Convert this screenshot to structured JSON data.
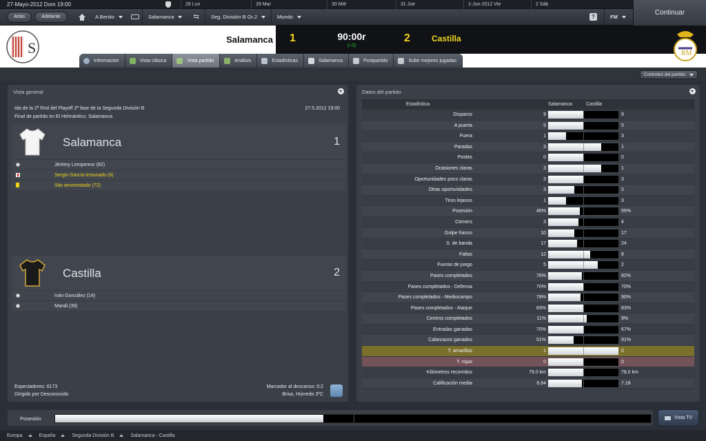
{
  "calendar": {
    "current_date": "27-Mayo-2012  Dom  19:00",
    "days": [
      "28  Lun",
      "29  Mar",
      "30  Mié",
      "31  Jue",
      "1-Jun-2012  Vie",
      "2  Sáb"
    ]
  },
  "nav": {
    "back": "Atrás",
    "forward": "Adelante",
    "manager": "A Benito",
    "club": "Salamanca",
    "competition": "Seg. División B Gr.2",
    "world": "Mundo",
    "help": "?",
    "fm": "FM",
    "continue": "Continuar"
  },
  "match": {
    "home_team": "Salamanca",
    "home_score": "1",
    "clock": "90:00r",
    "added_time": "(+3)",
    "away_score": "2",
    "away_team": "Castilla"
  },
  "tabs": [
    "Información",
    "Vista clásica",
    "Vista partido",
    "Análisis",
    "Estadísticas",
    "Salamanca",
    "Postpartido",
    "Subir mejores jugadas"
  ],
  "active_tab": 2,
  "controls_button": "Controles del partido",
  "overview": {
    "title": "Vista general",
    "competition": "Ida de la 2ª Rnd del Playoff 2ª fase de la Segunda División B",
    "datetime": "27.5.2012 19:00",
    "venue": "Final de partido en El Helmántico, Salamanca",
    "home": {
      "name": "Salamanca",
      "goals": "1",
      "events": [
        {
          "type": "goal",
          "text": "Jérémy Lempereur (82)"
        },
        {
          "type": "injury",
          "text": "Sergio García lesionado (6)"
        },
        {
          "type": "yellow",
          "text": "Sito amonestado (72)"
        }
      ]
    },
    "away": {
      "name": "Castilla",
      "goals": "2",
      "events": [
        {
          "type": "goal",
          "text": "Iván González (14)"
        },
        {
          "type": "goal",
          "text": "Mandi (39)"
        }
      ]
    },
    "attendance": "Espectadores: 6173",
    "referee": "Dirigido por Desconocido",
    "halftime": "Marcador al descanso: 0:2",
    "weather": "Brisa, Húmedo 3ºC"
  },
  "stats_panel": {
    "title": "Datos del partido",
    "col_stat": "Estadística",
    "col_home": "Salamanca",
    "col_away": "Castilla",
    "rows": [
      {
        "label": "Disparos",
        "home": "9",
        "away": "9",
        "share": 0.5
      },
      {
        "label": "A puerta",
        "home": "5",
        "away": "5",
        "share": 0.5
      },
      {
        "label": "Fuera",
        "home": "1",
        "away": "3",
        "share": 0.25
      },
      {
        "label": "Paradas",
        "home": "3",
        "away": "1",
        "share": 0.75
      },
      {
        "label": "Postes",
        "home": "0",
        "away": "0",
        "share": 0.5
      },
      {
        "label": "Ocasiones claras",
        "home": "3",
        "away": "1",
        "share": 0.75
      },
      {
        "label": "Oportunidades poco claras",
        "home": "3",
        "away": "3",
        "share": 0.5
      },
      {
        "label": "Otras oportunidades",
        "home": "3",
        "away": "5",
        "share": 0.375
      },
      {
        "label": "Tiros lejanos",
        "home": "1",
        "away": "3",
        "share": 0.25
      },
      {
        "label": "Posesión",
        "home": "45%",
        "away": "55%",
        "share": 0.45
      },
      {
        "label": "Córners",
        "home": "3",
        "away": "4",
        "share": 0.43
      },
      {
        "label": "Golpe franco",
        "home": "10",
        "away": "17",
        "share": 0.37
      },
      {
        "label": "S. de banda",
        "home": "17",
        "away": "24",
        "share": 0.41
      },
      {
        "label": "Faltas",
        "home": "12",
        "away": "8",
        "share": 0.6
      },
      {
        "label": "Fueras de juego",
        "home": "5",
        "away": "2",
        "share": 0.71
      },
      {
        "label": "Pases completados",
        "home": "76%",
        "away": "82%",
        "share": 0.48
      },
      {
        "label": "Pases completados - Defensa",
        "home": "70%",
        "away": "70%",
        "share": 0.5
      },
      {
        "label": "Pases completados - Mediocampo",
        "home": "78%",
        "away": "90%",
        "share": 0.46
      },
      {
        "label": "Pases completados - Ataque",
        "home": "83%",
        "away": "83%",
        "share": 0.5
      },
      {
        "label": "Centros completados",
        "home": "11%",
        "away": "9%",
        "share": 0.55
      },
      {
        "label": "Entradas ganadas",
        "home": "70%",
        "away": "67%",
        "share": 0.51
      },
      {
        "label": "Cabezazos ganados",
        "home": "51%",
        "away": "91%",
        "share": 0.36
      },
      {
        "label": "T. amarillas",
        "home": "1",
        "away": "0",
        "share": 1.0,
        "highlight": "yellow"
      },
      {
        "label": "T. rojas",
        "home": "0",
        "away": "0",
        "share": 0.5,
        "highlight": "red"
      },
      {
        "label": "Kilómetros recorridos",
        "home": "79.0 km",
        "away": "78.0 km",
        "share": 0.5
      },
      {
        "label": "Calificación media",
        "home": "6.64",
        "away": "7.18",
        "share": 0.48
      }
    ]
  },
  "possession": {
    "label": "Posesión",
    "home_share": 0.45
  },
  "tv_button": "Vista TV",
  "breadcrumbs": [
    "Europa",
    "España",
    "Segunda División B",
    "Salamanca - Castilla"
  ]
}
